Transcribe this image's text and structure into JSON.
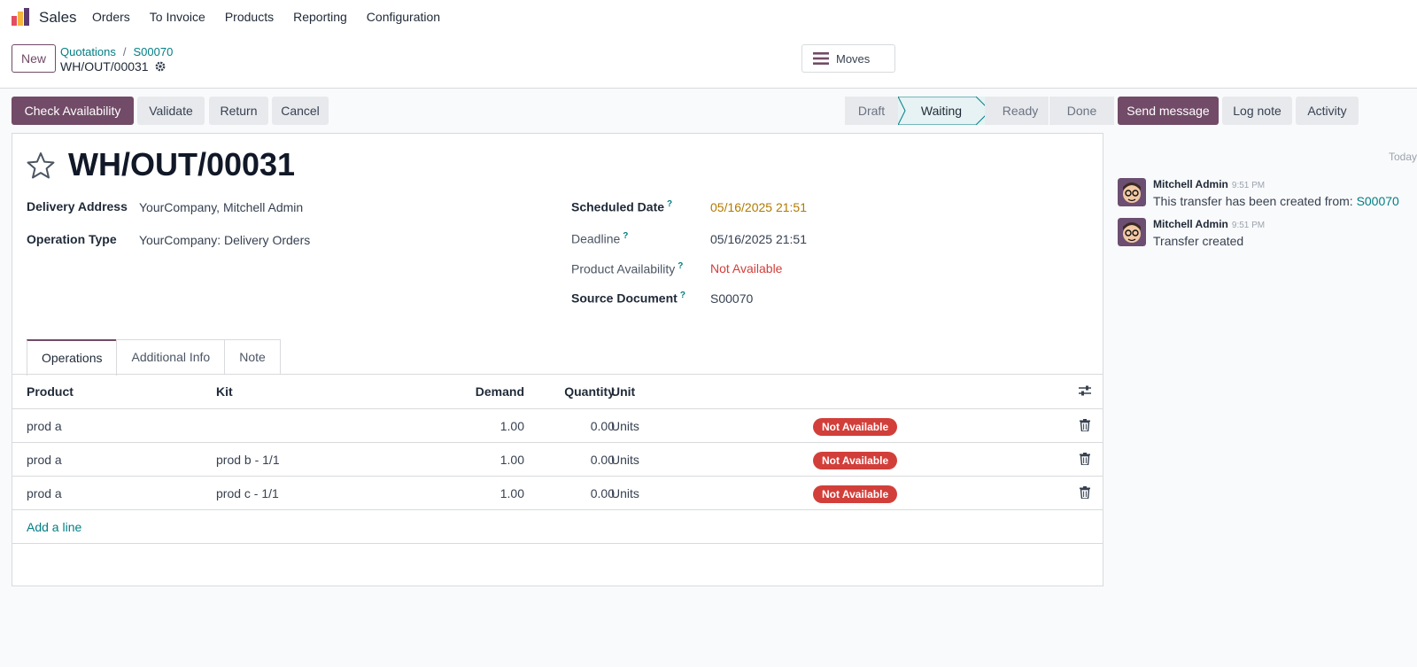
{
  "app": {
    "name": "Sales",
    "menu": [
      "Orders",
      "To Invoice",
      "Products",
      "Reporting",
      "Configuration"
    ]
  },
  "control_panel": {
    "new_label": "New",
    "breadcrumb": [
      "Quotations",
      "S00070"
    ],
    "breadcrumb_separator": "/",
    "current_record": "WH/OUT/00031",
    "moves_label": "Moves"
  },
  "actions": {
    "check_availability": "Check Availability",
    "validate": "Validate",
    "return": "Return",
    "cancel": "Cancel"
  },
  "stages": [
    {
      "label": "Draft",
      "active": false
    },
    {
      "label": "Waiting",
      "active": true
    },
    {
      "label": "Ready",
      "active": false
    },
    {
      "label": "Done",
      "active": false
    }
  ],
  "form": {
    "title": "WH/OUT/00031",
    "delivery_address_label": "Delivery Address",
    "delivery_address": "YourCompany, Mitchell Admin",
    "operation_type_label": "Operation Type",
    "operation_type": "YourCompany: Delivery Orders",
    "scheduled_date_label": "Scheduled Date",
    "scheduled_date": "05/16/2025 21:51",
    "deadline_label": "Deadline",
    "deadline": "05/16/2025 21:51",
    "availability_label": "Product Availability",
    "availability": "Not Available",
    "source_document_label": "Source Document",
    "source_document": "S00070",
    "help_marker": "?"
  },
  "tabs": [
    {
      "label": "Operations",
      "active": true
    },
    {
      "label": "Additional Info",
      "active": false
    },
    {
      "label": "Note",
      "active": false
    }
  ],
  "table": {
    "headers": {
      "product": "Product",
      "kit": "Kit",
      "demand": "Demand",
      "quantity": "Quantity",
      "unit": "Unit"
    },
    "rows": [
      {
        "product": "prod a",
        "kit": "",
        "demand": "1.00",
        "quantity": "0.00",
        "unit": "Units",
        "status": "Not Available"
      },
      {
        "product": "prod a",
        "kit": "prod b - 1/1",
        "demand": "1.00",
        "quantity": "0.00",
        "unit": "Units",
        "status": "Not Available"
      },
      {
        "product": "prod a",
        "kit": "prod c - 1/1",
        "demand": "1.00",
        "quantity": "0.00",
        "unit": "Units",
        "status": "Not Available"
      }
    ],
    "add_line": "Add a line"
  },
  "chatter": {
    "send_message": "Send message",
    "log_note": "Log note",
    "activity": "Activity",
    "date_separator": "Today",
    "messages": [
      {
        "author": "Mitchell Admin",
        "time": "9:51 PM",
        "body": "This transfer has been created from:",
        "link": "S00070"
      },
      {
        "author": "Mitchell Admin",
        "time": "9:51 PM",
        "body": "Transfer created",
        "link": ""
      }
    ]
  },
  "colors": {
    "primary": "#714b67",
    "link": "#017e84",
    "danger": "#d23f3a",
    "warning_date": "#b07a00"
  }
}
